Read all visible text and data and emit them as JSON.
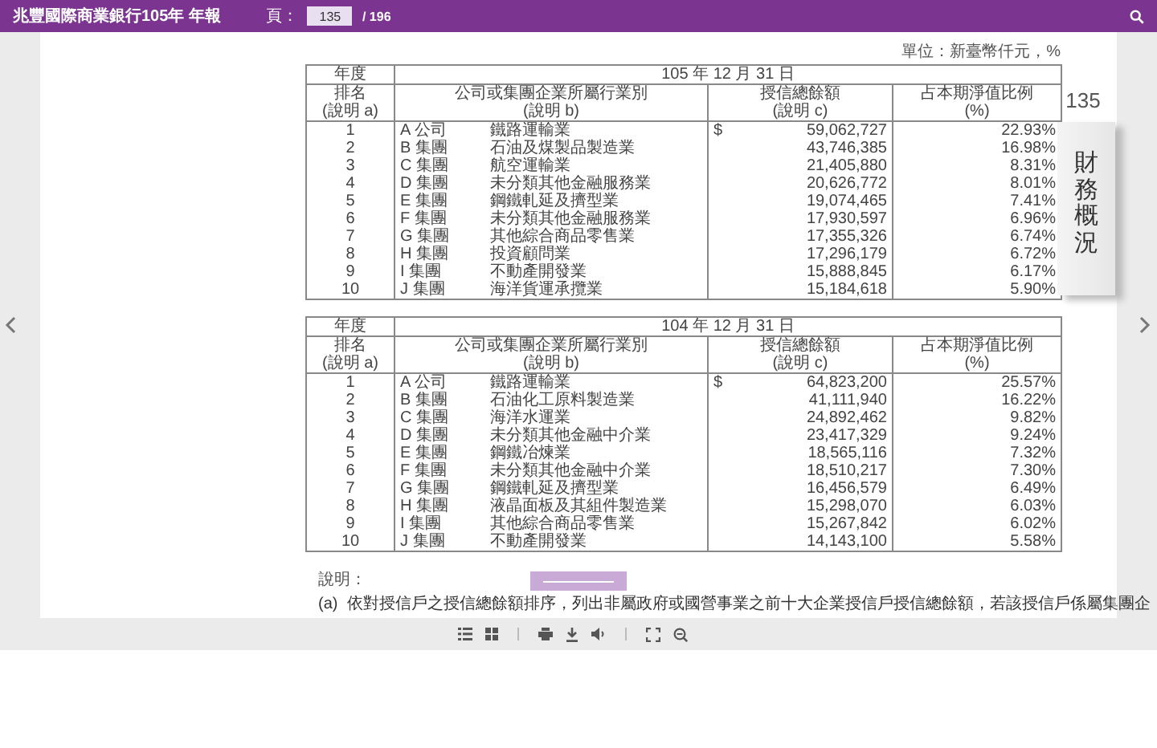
{
  "topbar": {
    "title": "兆豐國際商業銀行105年 年報",
    "page_label": "頁：",
    "page_value": "135",
    "page_total": "/ 196"
  },
  "unit": "單位：新臺幣仟元，%",
  "tables": [
    {
      "year_label": "年度",
      "date": "105 年 12 月 31 日",
      "columns": [
        {
          "title": "排名",
          "note": "(說明 a)"
        },
        {
          "title": "公司或集團企業所屬行業別",
          "note": "(說明 b)"
        },
        {
          "title": "授信總餘額",
          "note": "(說明 c)"
        },
        {
          "title": "占本期淨值比例",
          "note": "(%)"
        }
      ],
      "rows": [
        {
          "rank": "1",
          "company": "A 公司",
          "industry": "鐵路運輸業",
          "currency": "$",
          "amount": "59,062,727",
          "ratio": "22.93%"
        },
        {
          "rank": "2",
          "company": "B 集團",
          "industry": "石油及煤製品製造業",
          "amount": "43,746,385",
          "ratio": "16.98%"
        },
        {
          "rank": "3",
          "company": "C 集團",
          "industry": "航空運輸業",
          "amount": "21,405,880",
          "ratio": "8.31%"
        },
        {
          "rank": "4",
          "company": "D 集團",
          "industry": "未分類其他金融服務業",
          "amount": "20,626,772",
          "ratio": "8.01%"
        },
        {
          "rank": "5",
          "company": "E 集團",
          "industry": "鋼鐵軋延及擠型業",
          "amount": "19,074,465",
          "ratio": "7.41%"
        },
        {
          "rank": "6",
          "company": "F 集團",
          "industry": "未分類其他金融服務業",
          "amount": "17,930,597",
          "ratio": "6.96%"
        },
        {
          "rank": "7",
          "company": "G 集團",
          "industry": "其他綜合商品零售業",
          "amount": "17,355,326",
          "ratio": "6.74%"
        },
        {
          "rank": "8",
          "company": "H 集團",
          "industry": "投資顧問業",
          "amount": "17,296,179",
          "ratio": "6.72%"
        },
        {
          "rank": "9",
          "company": "I 集團",
          "industry": "不動產開發業",
          "amount": "15,888,845",
          "ratio": "6.17%"
        },
        {
          "rank": "10",
          "company": "J 集團",
          "industry": "海洋貨運承攬業",
          "amount": "15,184,618",
          "ratio": "5.90%"
        }
      ]
    },
    {
      "year_label": "年度",
      "date": "104 年 12 月 31 日",
      "columns": [
        {
          "title": "排名",
          "note": "(說明 a)"
        },
        {
          "title": "公司或集團企業所屬行業別",
          "note": "(說明 b)"
        },
        {
          "title": "授信總餘額",
          "note": "(說明 c)"
        },
        {
          "title": "占本期淨值比例",
          "note": "(%)"
        }
      ],
      "rows": [
        {
          "rank": "1",
          "company": "A 公司",
          "industry": "鐵路運輸業",
          "currency": "$",
          "amount": "64,823,200",
          "ratio": "25.57%"
        },
        {
          "rank": "2",
          "company": "B 集團",
          "industry": "石油化工原料製造業",
          "amount": "41,111,940",
          "ratio": "16.22%"
        },
        {
          "rank": "3",
          "company": "C 集團",
          "industry": "海洋水運業",
          "amount": "24,892,462",
          "ratio": "9.82%"
        },
        {
          "rank": "4",
          "company": "D 集團",
          "industry": "未分類其他金融中介業",
          "amount": "23,417,329",
          "ratio": "9.24%"
        },
        {
          "rank": "5",
          "company": "E 集團",
          "industry": "鋼鐵冶煉業",
          "amount": "18,565,116",
          "ratio": "7.32%"
        },
        {
          "rank": "6",
          "company": "F 集團",
          "industry": "未分類其他金融中介業",
          "amount": "18,510,217",
          "ratio": "7.30%"
        },
        {
          "rank": "7",
          "company": "G 集團",
          "industry": "鋼鐵軋延及擠型業",
          "amount": "16,456,579",
          "ratio": "6.49%"
        },
        {
          "rank": "8",
          "company": "H 集團",
          "industry": "液晶面板及其組件製造業",
          "amount": "15,298,070",
          "ratio": "6.03%"
        },
        {
          "rank": "9",
          "company": "I 集團",
          "industry": "其他綜合商品零售業",
          "amount": "15,267,842",
          "ratio": "6.02%"
        },
        {
          "rank": "10",
          "company": "J 集團",
          "industry": "不動產開發業",
          "amount": "14,143,100",
          "ratio": "5.58%"
        }
      ]
    }
  ],
  "notes": {
    "title": "說明：",
    "items": [
      {
        "label": "(a)",
        "text": "依對授信戶之授信總餘額排序，列出非屬政府或國營事業之前十大企業授信戶授信總餘額，若該授信戶係屬集團企"
      }
    ]
  },
  "side_tab": {
    "page_number": "135",
    "label": "財務概況"
  }
}
